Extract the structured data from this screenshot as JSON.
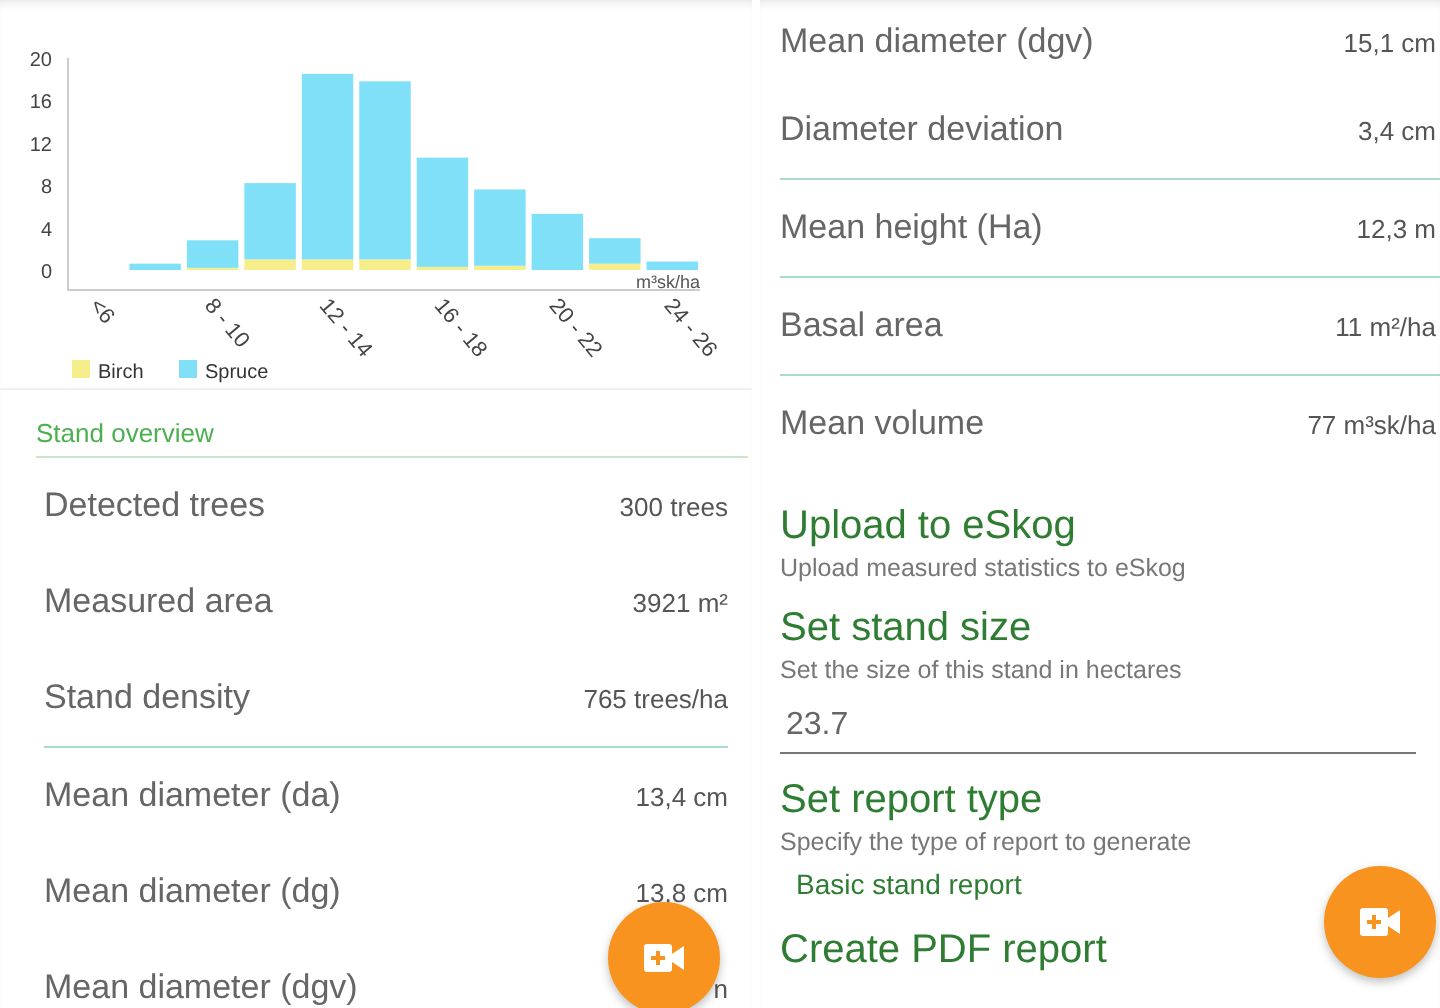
{
  "left_screen": {
    "chart_data": {
      "type": "bar",
      "stacked": true,
      "categories": [
        "<6",
        null,
        "8 - 10",
        null,
        "12 - 14",
        null,
        "16 - 18",
        null,
        "20 - 22",
        null,
        "24 - 26"
      ],
      "ylim": [
        0,
        20
      ],
      "yticks": [
        0,
        4,
        8,
        12,
        16,
        20
      ],
      "legend": true,
      "series": [
        {
          "name": "Birch",
          "color": "#f5ee8a",
          "values": [
            0,
            0,
            0.2,
            1,
            1,
            1,
            0.3,
            0.4,
            0,
            0.6,
            0
          ]
        },
        {
          "name": "Spruce",
          "color": "#7fe0f8",
          "values": [
            0,
            0.6,
            2.6,
            7.2,
            17.5,
            16.8,
            10.3,
            7.2,
            5.3,
            2.4,
            0.8
          ]
        }
      ]
    },
    "chart_unit": "m³sk/ha",
    "section_title": "Stand overview",
    "rows": [
      {
        "label": "Detected trees",
        "value": "300 trees",
        "divider_below": false
      },
      {
        "label": "Measured area",
        "value": "3921 m²",
        "divider_below": false
      },
      {
        "label": "Stand density",
        "value": "765 trees/ha",
        "divider_below": true
      },
      {
        "label": "Mean diameter (da)",
        "value": "13,4 cm",
        "divider_below": false
      },
      {
        "label": "Mean diameter (dg)",
        "value": "13,8 cm",
        "divider_below": false
      },
      {
        "label": "Mean diameter (dgv)",
        "value": "n",
        "divider_below": false
      }
    ]
  },
  "right_screen": {
    "rows": [
      {
        "label": "Mean diameter (dgv)",
        "value": "15,1 cm",
        "divider_below": false
      },
      {
        "label": "Diameter deviation",
        "value": "3,4 cm",
        "divider_below": true
      },
      {
        "label": "Mean height (Ha)",
        "value": "12,3 m",
        "divider_below": true
      },
      {
        "label": "Basal area",
        "value": "11 m²/ha",
        "divider_below": true
      },
      {
        "label": "Mean volume",
        "value": "77 m³sk/ha",
        "divider_below": false
      }
    ],
    "settings": [
      {
        "kind": "action",
        "title": "Upload to eSkog",
        "summary": "Upload measured statistics to eSkog"
      },
      {
        "kind": "input",
        "title": "Set stand size",
        "summary": "Set the size of this stand in hectares",
        "value": "23.7"
      },
      {
        "kind": "choice",
        "title": "Set report type",
        "summary": "Specify the type of report to generate",
        "value": "Basic stand report"
      },
      {
        "kind": "action",
        "title": "Create PDF report"
      }
    ]
  }
}
